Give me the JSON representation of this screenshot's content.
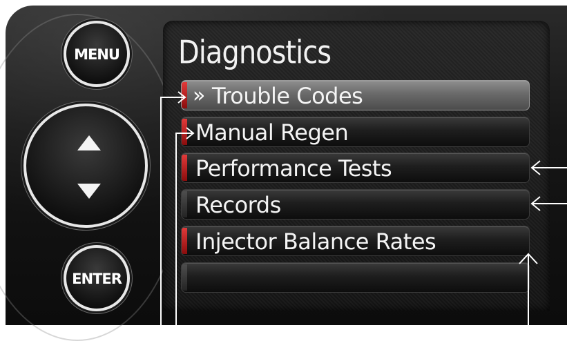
{
  "screen": {
    "title": "Diagnostics",
    "items": [
      {
        "label": "Trouble Codes",
        "selected": true,
        "accent": "red",
        "cursor": "»"
      },
      {
        "label": "Manual Regen",
        "selected": false,
        "accent": "red"
      },
      {
        "label": "Performance Tests",
        "selected": false,
        "accent": "red"
      },
      {
        "label": "Records",
        "selected": false,
        "accent": "gray"
      },
      {
        "label": "Injector Balance Rates",
        "selected": false,
        "accent": "red"
      },
      {
        "label": "",
        "selected": false,
        "accent": "gray"
      }
    ]
  },
  "buttons": {
    "menu_label": "MENU",
    "enter_label": "ENTER",
    "nav_up_icon": "up-triangle-icon",
    "nav_down_icon": "down-triangle-icon"
  },
  "colors": {
    "accent_red": "#c81e1e",
    "bezel": "#161616",
    "screen_bg": "#1a1a1a",
    "text": "#f2f2f2"
  }
}
